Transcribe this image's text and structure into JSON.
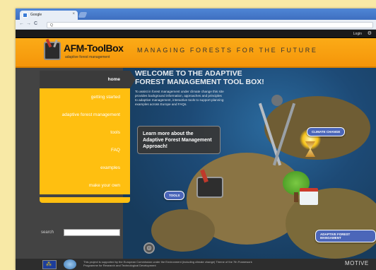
{
  "browser": {
    "tab_title": "Google",
    "tab_close": "×",
    "back": "←",
    "forward": "→",
    "reload": "C",
    "search_glyph": "Q",
    "address": ""
  },
  "site_bar": {
    "login": "Login",
    "settings_glyph": "⚙"
  },
  "header": {
    "logo_title": "AFM-ToolBox",
    "logo_subtitle": "adaptive forest management",
    "tagline": "MANAGING FORESTS FOR THE FUTURE"
  },
  "nav": {
    "items": [
      {
        "label": "home",
        "active": true
      },
      {
        "label": "getting started",
        "active": false
      },
      {
        "label": "adaptive forest management",
        "active": false
      },
      {
        "label": "tools",
        "active": false
      },
      {
        "label": "FAQ",
        "active": false
      },
      {
        "label": "examples",
        "active": false
      },
      {
        "label": "make your own",
        "active": false
      }
    ]
  },
  "search": {
    "label": "search",
    "value": ""
  },
  "content": {
    "welcome_title": "WELCOME TO THE ADAPTIVE FOREST MANAGEMENT TOOL BOX!",
    "intro": "To assist in forest management under climate change this site provides background information, approaches and principles to adaptive management, interactive tools to support planning examples across Europe and FAQs.",
    "learn_more": "Learn more about the Adaptive Forest Management Approach!",
    "climate_change": "CLIMATE CHANGE",
    "tools": "TOOLS",
    "adaptive_label": "ADAPTIVE FOREST MANGAMENT",
    "toggle_glyph": "◎"
  },
  "footer": {
    "funding": "This project is supported by the European Commission under the Environment (including climate change) Theme of the 7th Framework Programme for Research and Technological Development",
    "partner": "MOTIVE"
  },
  "colors": {
    "accent": "#f59509",
    "nav_bg": "#ffbf10",
    "dark": "#3b3b3b",
    "pill": "#4b66b9"
  }
}
